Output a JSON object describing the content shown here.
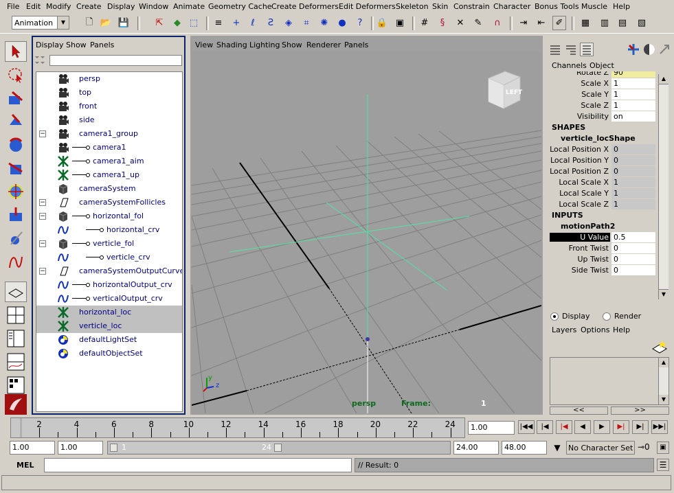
{
  "menus": [
    "File",
    "Edit",
    "Modify",
    "Create",
    "Display",
    "Window",
    "Animate",
    "Geometry Cache",
    "Create Deformers",
    "Edit Deformers",
    "Skeleton",
    "Skin",
    "Constrain",
    "Character",
    "Bonus Tools",
    "Muscle",
    "Help"
  ],
  "mode": "Animation",
  "outliner": {
    "menus": [
      "Display",
      "Show",
      "Panels"
    ],
    "items": [
      {
        "label": "persp",
        "icon": "camera-icon",
        "indent": 0,
        "expand": ""
      },
      {
        "label": "top",
        "icon": "camera-icon",
        "indent": 0,
        "expand": ""
      },
      {
        "label": "front",
        "icon": "camera-icon",
        "indent": 0,
        "expand": ""
      },
      {
        "label": "side",
        "icon": "camera-icon",
        "indent": 0,
        "expand": ""
      },
      {
        "label": "camera1_group",
        "icon": "camera-icon",
        "indent": 0,
        "expand": "−"
      },
      {
        "label": "camera1",
        "icon": "camera-icon",
        "indent": 1,
        "expand": ""
      },
      {
        "label": "camera1_aim",
        "icon": "locator-icon",
        "indent": 1,
        "expand": ""
      },
      {
        "label": "camera1_up",
        "icon": "locator-icon",
        "indent": 1,
        "expand": ""
      },
      {
        "label": "cameraSystem",
        "icon": "group-icon",
        "indent": 0,
        "expand": ""
      },
      {
        "label": "cameraSystemFollicles",
        "icon": "parallelogram-icon",
        "indent": 0,
        "expand": "−"
      },
      {
        "label": "horizontal_fol",
        "icon": "group-icon",
        "indent": 1,
        "expand": "−"
      },
      {
        "label": "horizontal_crv",
        "icon": "curve-icon",
        "indent": 2,
        "expand": ""
      },
      {
        "label": "verticle_fol",
        "icon": "group-icon",
        "indent": 1,
        "expand": "−"
      },
      {
        "label": "verticle_crv",
        "icon": "curve-icon",
        "indent": 2,
        "expand": ""
      },
      {
        "label": "cameraSystemOutputCurves",
        "icon": "parallelogram-icon",
        "indent": 0,
        "expand": "−"
      },
      {
        "label": "horizontalOutput_crv",
        "icon": "curve-icon",
        "indent": 1,
        "expand": ""
      },
      {
        "label": "verticalOutput_crv",
        "icon": "curve-icon",
        "indent": 1,
        "expand": ""
      },
      {
        "label": "horizontal_loc",
        "icon": "locator-icon",
        "indent": 0,
        "expand": "",
        "selected": true
      },
      {
        "label": "verticle_loc",
        "icon": "locator-icon",
        "indent": 0,
        "expand": "",
        "selected": true
      },
      {
        "label": "defaultLightSet",
        "icon": "set-icon",
        "indent": 0,
        "expand": ""
      },
      {
        "label": "defaultObjectSet",
        "icon": "set-icon",
        "indent": 0,
        "expand": ""
      }
    ]
  },
  "viewport": {
    "menus": [
      "View",
      "Shading",
      "Lighting",
      "Show",
      "Renderer",
      "Panels"
    ],
    "cube_label": "LEFT",
    "camera_label": "persp",
    "frame_label": "Frame:",
    "frame_value": "1",
    "axis_y": "y",
    "axis_z": "z"
  },
  "channelbox": {
    "tabs": [
      "Channels",
      "Object"
    ],
    "top_rows": [
      {
        "label": "Rotate Z",
        "value": "90",
        "style": "yel"
      },
      {
        "label": "Scale X",
        "value": "1",
        "style": ""
      },
      {
        "label": "Scale Y",
        "value": "1",
        "style": ""
      },
      {
        "label": "Scale Z",
        "value": "1",
        "style": ""
      },
      {
        "label": "Visibility",
        "value": "on",
        "style": ""
      }
    ],
    "shapes_heading": "SHAPES",
    "shape_name": "verticle_locShape",
    "shape_rows": [
      {
        "label": "Local Position X",
        "value": "0"
      },
      {
        "label": "Local Position Y",
        "value": "0"
      },
      {
        "label": "Local Position Z",
        "value": "0"
      },
      {
        "label": "Local Scale X",
        "value": "1"
      },
      {
        "label": "Local Scale Y",
        "value": "1"
      },
      {
        "label": "Local Scale Z",
        "value": "1"
      }
    ],
    "inputs_heading": "INPUTS",
    "input_name": "motionPath2",
    "input_rows": [
      {
        "label": "U Value",
        "value": "0.5",
        "highlight": true
      },
      {
        "label": "Front Twist",
        "value": "0"
      },
      {
        "label": "Up Twist",
        "value": "0"
      },
      {
        "label": "Side Twist",
        "value": "0"
      }
    ]
  },
  "layers": {
    "display_label": "Display",
    "render_label": "Render",
    "menus": [
      "Layers",
      "Options",
      "Help"
    ],
    "left_arrows": "<<",
    "right_arrows": ">>"
  },
  "timeline": {
    "ticks": [
      "2",
      "4",
      "6",
      "8",
      "10",
      "12",
      "14",
      "16",
      "18",
      "20",
      "22",
      "24"
    ],
    "current_frame": "1.00"
  },
  "range": {
    "start": "1.00",
    "playback_start": "1.00",
    "slider_start": "1",
    "slider_end": "24",
    "playback_end": "24.00",
    "end": "48.00",
    "character_set": "No Character Set"
  },
  "cmdline": {
    "label": "MEL",
    "result": "// Result: 0"
  }
}
